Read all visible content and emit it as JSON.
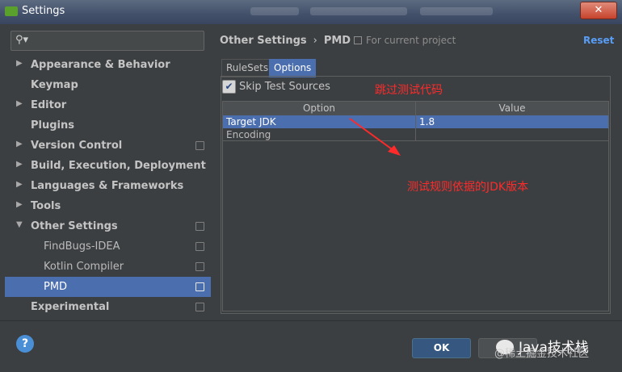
{
  "window": {
    "title": "Settings",
    "close_label": "✕"
  },
  "search": {
    "placeholder": ""
  },
  "sidebar": {
    "items": [
      {
        "label": "Appearance & Behavior",
        "level": "top",
        "expandable": true,
        "expanded": false,
        "copy": false,
        "selected": false
      },
      {
        "label": "Keymap",
        "level": "top",
        "expandable": false,
        "expanded": false,
        "copy": false,
        "selected": false
      },
      {
        "label": "Editor",
        "level": "top",
        "expandable": true,
        "expanded": false,
        "copy": false,
        "selected": false
      },
      {
        "label": "Plugins",
        "level": "top",
        "expandable": false,
        "expanded": false,
        "copy": false,
        "selected": false
      },
      {
        "label": "Version Control",
        "level": "top",
        "expandable": true,
        "expanded": false,
        "copy": true,
        "selected": false
      },
      {
        "label": "Build, Execution, Deployment",
        "level": "top",
        "expandable": true,
        "expanded": false,
        "copy": false,
        "selected": false
      },
      {
        "label": "Languages & Frameworks",
        "level": "top",
        "expandable": true,
        "expanded": false,
        "copy": false,
        "selected": false
      },
      {
        "label": "Tools",
        "level": "top",
        "expandable": true,
        "expanded": false,
        "copy": false,
        "selected": false
      },
      {
        "label": "Other Settings",
        "level": "top",
        "expandable": true,
        "expanded": true,
        "copy": true,
        "selected": false
      },
      {
        "label": "FindBugs-IDEA",
        "level": "sub",
        "expandable": false,
        "expanded": false,
        "copy": true,
        "selected": false
      },
      {
        "label": "Kotlin Compiler",
        "level": "sub",
        "expandable": false,
        "expanded": false,
        "copy": true,
        "selected": false
      },
      {
        "label": "PMD",
        "level": "sub",
        "expandable": false,
        "expanded": false,
        "copy": true,
        "selected": true
      },
      {
        "label": "Experimental",
        "level": "top",
        "expandable": false,
        "expanded": false,
        "copy": true,
        "selected": false
      }
    ]
  },
  "breadcrumb": {
    "parent": "Other Settings",
    "separator": "›",
    "current": "PMD"
  },
  "scope_label": "For current project",
  "reset_label": "Reset",
  "tabs": [
    {
      "label": "RuleSets",
      "active": false
    },
    {
      "label": "Options",
      "active": true
    }
  ],
  "options": {
    "skip_test_sources": {
      "label": "Skip Test Sources",
      "checked": true
    },
    "table": {
      "headers": [
        "Option",
        "Value"
      ],
      "rows": [
        {
          "option": "Target JDK",
          "value": "1.8",
          "selected": true
        },
        {
          "option": "Encoding",
          "value": "",
          "selected": false
        }
      ]
    }
  },
  "annotations": {
    "skip_note": "跳过测试代码",
    "jdk_note": "测试规则依据的JDK版本",
    "color": "#ff2a2a"
  },
  "footer": {
    "ok_label": "OK",
    "help_label": "?"
  },
  "watermark": {
    "primary": "Java技术栈",
    "secondary": "@稀土掘金技术社区"
  },
  "colors": {
    "selection": "#4b6eaf",
    "link": "#589df6",
    "background": "#3c3f41"
  }
}
